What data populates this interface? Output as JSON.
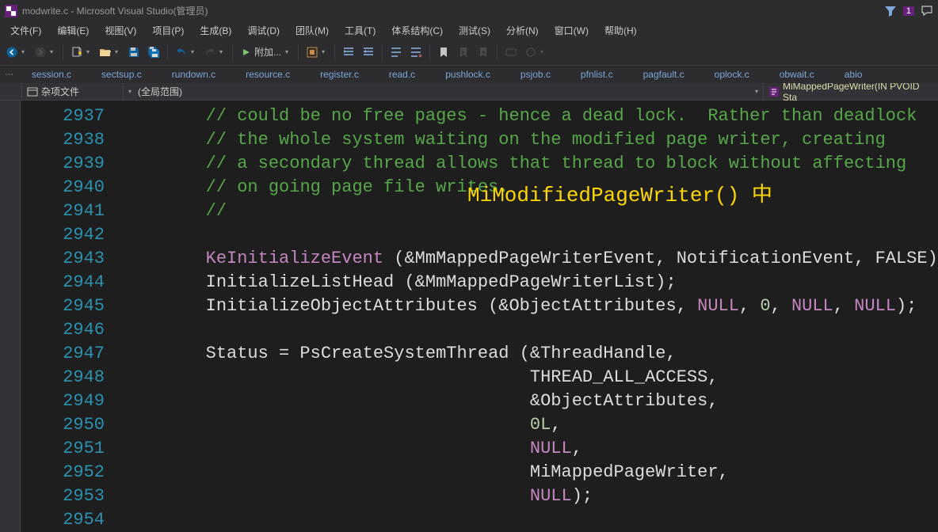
{
  "title": "modwrite.c - Microsoft Visual Studio(管理员)",
  "badge_count": "1",
  "menu": [
    "文件(F)",
    "编辑(E)",
    "视图(V)",
    "项目(P)",
    "生成(B)",
    "调试(D)",
    "团队(M)",
    "工具(T)",
    "体系结构(C)",
    "测试(S)",
    "分析(N)",
    "窗口(W)",
    "帮助(H)"
  ],
  "toolbar": {
    "attach_label": "附加..."
  },
  "filetabs": [
    "session.c",
    "sectsup.c",
    "rundown.c",
    "resource.c",
    "register.c",
    "read.c",
    "pushlock.c",
    "psjob.c",
    "pfnlist.c",
    "pagfault.c",
    "oplock.c",
    "obwait.c",
    "abio"
  ],
  "navrow": {
    "scope": "杂项文件",
    "middle": "(全局范围)",
    "func": "MiMappedPageWriter(IN PVOID Sta"
  },
  "annotation": "MiModifiedPageWriter() 中",
  "code_lines": [
    {
      "n": 2937,
      "seg": [
        {
          "t": "        ",
          "c": ""
        },
        {
          "t": "// could be no free pages - hence a dead lock.  Rather than deadlock",
          "c": "c-cmt"
        }
      ]
    },
    {
      "n": 2938,
      "seg": [
        {
          "t": "        ",
          "c": ""
        },
        {
          "t": "// the whole system waiting on the modified page writer, creating",
          "c": "c-cmt"
        }
      ]
    },
    {
      "n": 2939,
      "seg": [
        {
          "t": "        ",
          "c": ""
        },
        {
          "t": "// a secondary thread allows that thread to block without affecting",
          "c": "c-cmt"
        }
      ]
    },
    {
      "n": 2940,
      "seg": [
        {
          "t": "        ",
          "c": ""
        },
        {
          "t": "// on going page file writes.",
          "c": "c-cmt"
        }
      ]
    },
    {
      "n": 2941,
      "seg": [
        {
          "t": "        ",
          "c": ""
        },
        {
          "t": "//",
          "c": "c-cmt"
        }
      ]
    },
    {
      "n": 2942,
      "seg": []
    },
    {
      "n": 2943,
      "seg": [
        {
          "t": "        ",
          "c": ""
        },
        {
          "t": "KeInitializeEvent",
          "c": "c-fn"
        },
        {
          "t": " (&MmMappedPageWriterEvent, NotificationEvent, FALSE);",
          "c": ""
        }
      ]
    },
    {
      "n": 2944,
      "seg": [
        {
          "t": "        InitializeListHead (&MmMappedPageWriterList);",
          "c": ""
        }
      ]
    },
    {
      "n": 2945,
      "seg": [
        {
          "t": "        InitializeObjectAttributes (&ObjectAttributes, ",
          "c": ""
        },
        {
          "t": "NULL",
          "c": "c-kw"
        },
        {
          "t": ", ",
          "c": ""
        },
        {
          "t": "0",
          "c": "c-num"
        },
        {
          "t": ", ",
          "c": ""
        },
        {
          "t": "NULL",
          "c": "c-kw"
        },
        {
          "t": ", ",
          "c": ""
        },
        {
          "t": "NULL",
          "c": "c-kw"
        },
        {
          "t": ");",
          "c": ""
        }
      ]
    },
    {
      "n": 2946,
      "seg": []
    },
    {
      "n": 2947,
      "seg": [
        {
          "t": "        Status = PsCreateSystemThread (&ThreadHandle,",
          "c": ""
        }
      ]
    },
    {
      "n": 2948,
      "seg": [
        {
          "t": "                                       THREAD_ALL_ACCESS,",
          "c": ""
        }
      ]
    },
    {
      "n": 2949,
      "seg": [
        {
          "t": "                                       &ObjectAttributes,",
          "c": ""
        }
      ]
    },
    {
      "n": 2950,
      "seg": [
        {
          "t": "                                       ",
          "c": ""
        },
        {
          "t": "0L",
          "c": "c-num"
        },
        {
          "t": ",",
          "c": ""
        }
      ]
    },
    {
      "n": 2951,
      "seg": [
        {
          "t": "                                       ",
          "c": ""
        },
        {
          "t": "NULL",
          "c": "c-kw"
        },
        {
          "t": ",",
          "c": ""
        }
      ]
    },
    {
      "n": 2952,
      "seg": [
        {
          "t": "                                       MiMappedPageWriter,",
          "c": ""
        }
      ]
    },
    {
      "n": 2953,
      "seg": [
        {
          "t": "                                       ",
          "c": ""
        },
        {
          "t": "NULL",
          "c": "c-kw"
        },
        {
          "t": ");",
          "c": ""
        }
      ]
    },
    {
      "n": 2954,
      "seg": []
    }
  ]
}
